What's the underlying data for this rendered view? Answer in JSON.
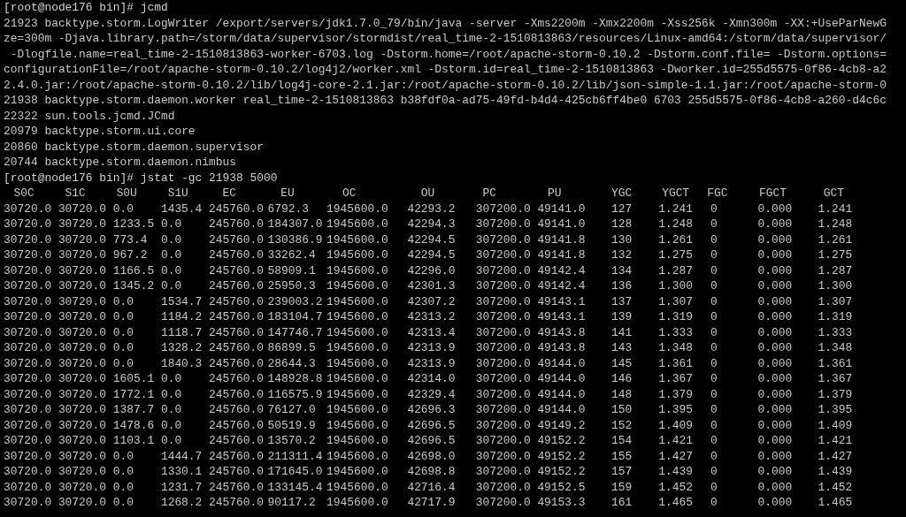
{
  "terminal": {
    "lines": [
      {
        "kind": "prompt",
        "text": "[root@node176 bin]# jcmd"
      },
      {
        "kind": "output",
        "text": "21923 backtype.storm.LogWriter /export/servers/jdk1.7.0_79/bin/java -server -Xms2200m -Xmx2200m -Xss256k -Xmn300m -XX:+UseParNewG"
      },
      {
        "kind": "output",
        "text": "ze=300m -Djava.library.path=/storm/data/supervisor/stormdist/real_time-2-1510813863/resources/Linux-amd64:/storm/data/supervisor/"
      },
      {
        "kind": "output",
        "text": " -Dlogfile.name=real_time-2-1510813863-worker-6703.log -Dstorm.home=/root/apache-storm-0.10.2 -Dstorm.conf.file= -Dstorm.options="
      },
      {
        "kind": "output",
        "text": "configurationFile=/root/apache-storm-0.10.2/log4j2/worker.xml -Dstorm.id=real_time-2-1510813863 -Dworker.id=255d5575-0f86-4cb8-a2"
      },
      {
        "kind": "output",
        "text": "2.4.0.jar:/root/apache-storm-0.10.2/lib/log4j-core-2.1.jar:/root/apache-storm-0.10.2/lib/json-simple-1.1.jar:/root/apache-storm-0"
      },
      {
        "kind": "output",
        "text": "21938 backtype.storm.daemon.worker real_time-2-1510813863 b38fdf0a-ad75-49fd-b4d4-425cb6ff4be0 6703 255d5575-0f86-4cb8-a260-d4c6c"
      },
      {
        "kind": "output",
        "text": "22322 sun.tools.jcmd.JCmd"
      },
      {
        "kind": "output",
        "text": "20979 backtype.storm.ui.core"
      },
      {
        "kind": "output",
        "text": "20860 backtype.storm.daemon.supervisor"
      },
      {
        "kind": "output",
        "text": "20744 backtype.storm.daemon.nimbus"
      },
      {
        "kind": "prompt",
        "text": "[root@node176 bin]# jstat -gc 21938 5000"
      }
    ],
    "table": {
      "columns": [
        "S0C",
        "S1C",
        "S0U",
        "S1U",
        "EC",
        "EU",
        "OC",
        "OU",
        "PC",
        "PU",
        "YGC",
        "YGCT",
        "FGC",
        "FGCT",
        "GCT"
      ],
      "rows": [
        [
          "30720.0",
          "30720.0",
          "0.0",
          "1435.4",
          "245760.0",
          "6792.3",
          "1945600.0",
          "42293.2",
          "307200.0",
          "49141.0",
          "127",
          "1.241",
          "0",
          "0.000",
          "1.241"
        ],
        [
          "30720.0",
          "30720.0",
          "1233.5",
          "0.0",
          "245760.0",
          "184307.0",
          "1945600.0",
          "42294.3",
          "307200.0",
          "49141.0",
          "128",
          "1.248",
          "0",
          "0.000",
          "1.248"
        ],
        [
          "30720.0",
          "30720.0",
          "773.4",
          "0.0",
          "245760.0",
          "130386.9",
          "1945600.0",
          "42294.5",
          "307200.0",
          "49141.8",
          "130",
          "1.261",
          "0",
          "0.000",
          "1.261"
        ],
        [
          "30720.0",
          "30720.0",
          "967.2",
          "0.0",
          "245760.0",
          "33262.4",
          "1945600.0",
          "42294.5",
          "307200.0",
          "49141.8",
          "132",
          "1.275",
          "0",
          "0.000",
          "1.275"
        ],
        [
          "30720.0",
          "30720.0",
          "1166.5",
          "0.0",
          "245760.0",
          "58909.1",
          "1945600.0",
          "42296.0",
          "307200.0",
          "49142.4",
          "134",
          "1.287",
          "0",
          "0.000",
          "1.287"
        ],
        [
          "30720.0",
          "30720.0",
          "1345.2",
          "0.0",
          "245760.0",
          "25950.3",
          "1945600.0",
          "42301.3",
          "307200.0",
          "49142.4",
          "136",
          "1.300",
          "0",
          "0.000",
          "1.300"
        ],
        [
          "30720.0",
          "30720.0",
          "0.0",
          "1534.7",
          "245760.0",
          "239003.2",
          "1945600.0",
          "42307.2",
          "307200.0",
          "49143.1",
          "137",
          "1.307",
          "0",
          "0.000",
          "1.307"
        ],
        [
          "30720.0",
          "30720.0",
          "0.0",
          "1184.2",
          "245760.0",
          "183104.7",
          "1945600.0",
          "42313.2",
          "307200.0",
          "49143.1",
          "139",
          "1.319",
          "0",
          "0.000",
          "1.319"
        ],
        [
          "30720.0",
          "30720.0",
          "0.0",
          "1118.7",
          "245760.0",
          "147746.7",
          "1945600.0",
          "42313.4",
          "307200.0",
          "49143.8",
          "141",
          "1.333",
          "0",
          "0.000",
          "1.333"
        ],
        [
          "30720.0",
          "30720.0",
          "0.0",
          "1328.2",
          "245760.0",
          "86899.5",
          "1945600.0",
          "42313.9",
          "307200.0",
          "49143.8",
          "143",
          "1.348",
          "0",
          "0.000",
          "1.348"
        ],
        [
          "30720.0",
          "30720.0",
          "0.0",
          "1840.3",
          "245760.0",
          "28644.3",
          "1945600.0",
          "42313.9",
          "307200.0",
          "49144.0",
          "145",
          "1.361",
          "0",
          "0.000",
          "1.361"
        ],
        [
          "30720.0",
          "30720.0",
          "1605.1",
          "0.0",
          "245760.0",
          "148928.8",
          "1945600.0",
          "42314.0",
          "307200.0",
          "49144.0",
          "146",
          "1.367",
          "0",
          "0.000",
          "1.367"
        ],
        [
          "30720.0",
          "30720.0",
          "1772.1",
          "0.0",
          "245760.0",
          "116575.9",
          "1945600.0",
          "42329.4",
          "307200.0",
          "49144.0",
          "148",
          "1.379",
          "0",
          "0.000",
          "1.379"
        ],
        [
          "30720.0",
          "30720.0",
          "1387.7",
          "0.0",
          "245760.0",
          "76127.0",
          "1945600.0",
          "42696.3",
          "307200.0",
          "49144.0",
          "150",
          "1.395",
          "0",
          "0.000",
          "1.395"
        ],
        [
          "30720.0",
          "30720.0",
          "1478.6",
          "0.0",
          "245760.0",
          "50519.9",
          "1945600.0",
          "42696.5",
          "307200.0",
          "49149.2",
          "152",
          "1.409",
          "0",
          "0.000",
          "1.409"
        ],
        [
          "30720.0",
          "30720.0",
          "1103.1",
          "0.0",
          "245760.0",
          "13570.2",
          "1945600.0",
          "42696.5",
          "307200.0",
          "49152.2",
          "154",
          "1.421",
          "0",
          "0.000",
          "1.421"
        ],
        [
          "30720.0",
          "30720.0",
          "0.0",
          "1444.7",
          "245760.0",
          "211311.4",
          "1945600.0",
          "42698.0",
          "307200.0",
          "49152.2",
          "155",
          "1.427",
          "0",
          "0.000",
          "1.427"
        ],
        [
          "30720.0",
          "30720.0",
          "0.0",
          "1330.1",
          "245760.0",
          "171645.0",
          "1945600.0",
          "42698.8",
          "307200.0",
          "49152.2",
          "157",
          "1.439",
          "0",
          "0.000",
          "1.439"
        ],
        [
          "30720.0",
          "30720.0",
          "0.0",
          "1231.7",
          "245760.0",
          "133145.4",
          "1945600.0",
          "42716.4",
          "307200.0",
          "49152.5",
          "159",
          "1.452",
          "0",
          "0.000",
          "1.452"
        ],
        [
          "30720.0",
          "30720.0",
          "0.0",
          "1268.2",
          "245760.0",
          "90117.2",
          "1945600.0",
          "42717.9",
          "307200.0",
          "49153.3",
          "161",
          "1.465",
          "0",
          "0.000",
          "1.465"
        ]
      ]
    }
  }
}
